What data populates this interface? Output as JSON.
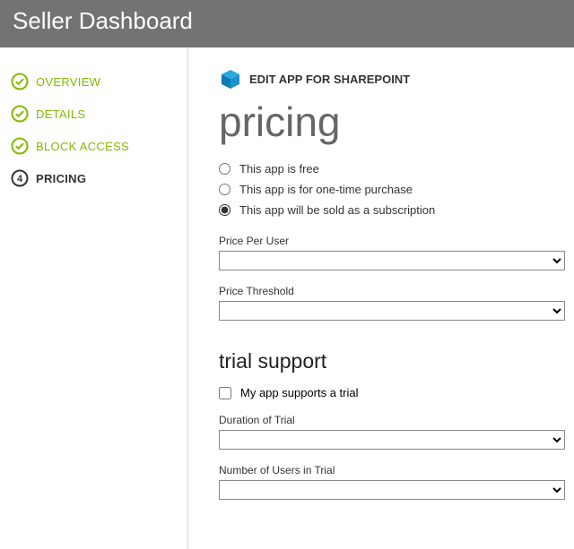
{
  "header": {
    "title": "Seller Dashboard"
  },
  "sidebar": {
    "items": [
      {
        "label": "OVERVIEW",
        "state": "done"
      },
      {
        "label": "DETAILS",
        "state": "done"
      },
      {
        "label": "BLOCK ACCESS",
        "state": "done"
      },
      {
        "label": "PRICING",
        "state": "current",
        "number": "4"
      }
    ]
  },
  "main": {
    "edit_label": "EDIT APP FOR SHAREPOINT",
    "heading": "pricing",
    "radios": {
      "free": "This app is free",
      "onetime": "This app is for one-time purchase",
      "subscription": "This app will be sold as a subscription",
      "selected": "subscription"
    },
    "price_per_user_label": "Price Per User",
    "price_threshold_label": "Price Threshold",
    "trial_heading": "trial support",
    "trial_checkbox_label": "My app supports a trial",
    "trial_checked": false,
    "duration_label": "Duration of Trial",
    "num_users_label": "Number of Users in Trial"
  }
}
